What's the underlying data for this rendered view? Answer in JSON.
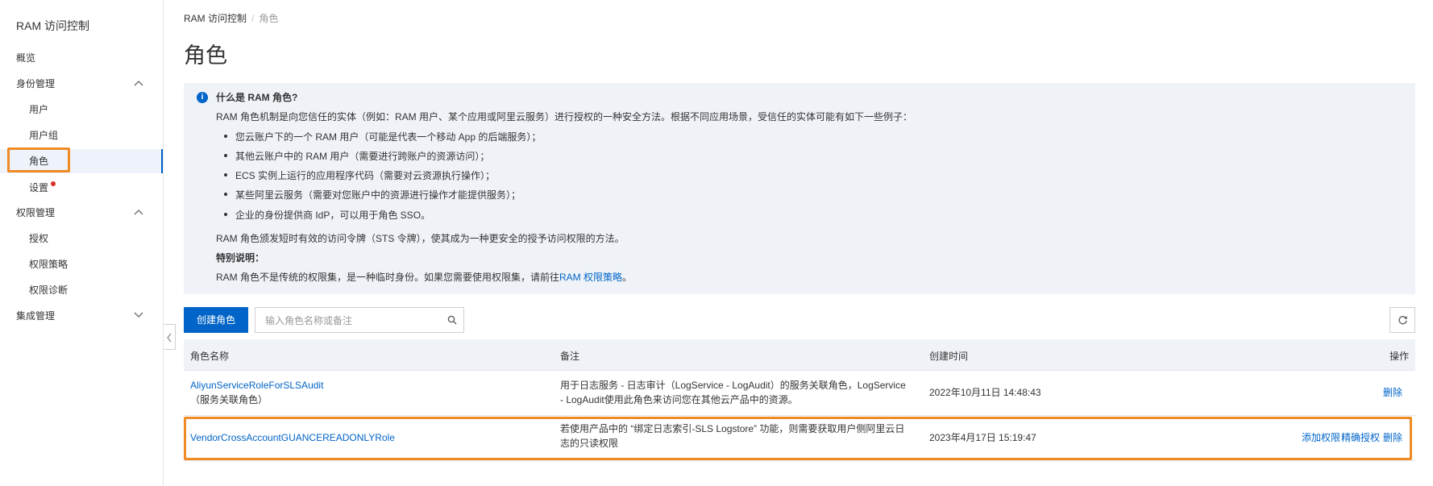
{
  "sidebar": {
    "title": "RAM 访问控制",
    "items": [
      {
        "label": "概览"
      },
      {
        "label": "身份管理"
      },
      {
        "label": "用户"
      },
      {
        "label": "用户组"
      },
      {
        "label": "角色"
      },
      {
        "label": "设置"
      },
      {
        "label": "权限管理"
      },
      {
        "label": "授权"
      },
      {
        "label": "权限策略"
      },
      {
        "label": "权限诊断"
      },
      {
        "label": "集成管理"
      }
    ],
    "active_item": "角色"
  },
  "breadcrumb": {
    "root": "RAM 访问控制",
    "current": "角色"
  },
  "page_title": "角色",
  "info": {
    "title": "什么是 RAM 角色?",
    "intro": "RAM 角色机制是向您信任的实体（例如：RAM 用户、某个应用或阿里云服务）进行授权的一种安全方法。根据不同应用场景，受信任的实体可能有如下一些例子：",
    "bullets": [
      "您云账户下的一个 RAM 用户（可能是代表一个移动 App 的后端服务）；",
      "其他云账户中的 RAM 用户（需要进行跨账户的资源访问）；",
      "ECS 实例上运行的应用程序代码（需要对云资源执行操作）；",
      "某些阿里云服务（需要对您账户中的资源进行操作才能提供服务）；",
      "企业的身份提供商 IdP，可以用于角色 SSO。"
    ],
    "sts_line": "RAM 角色颁发短时有效的访问令牌（STS 令牌），使其成为一种更安全的授予访问权限的方法。",
    "special_title": "特别说明：",
    "special_text": "RAM 角色不是传统的权限集，是一种临时身份。如果您需要使用权限集，请前往",
    "special_link": "RAM 权限策略",
    "special_end": "。"
  },
  "toolbar": {
    "create_label": "创建角色",
    "search_placeholder": "输入角色名称或备注"
  },
  "table": {
    "headers": [
      "角色名称",
      "备注",
      "创建时间",
      "操作"
    ],
    "rows": [
      {
        "name": "AliyunServiceRoleForSLSAudit",
        "tag": "（服务关联角色）",
        "note_line1": "用于日志服务 - 日志审计（LogService - LogAudit）的服务关联角色，LogService",
        "note_line2": "- LogAudit使用此角色来访问您在其他云产品中的资源。",
        "created": "2022年10月11日 14:48:43",
        "actions": [
          "删除"
        ]
      },
      {
        "name": "VendorCrossAccountGUANCEREADONLYRole",
        "note_line1": "若使用产品中的 “绑定日志索引-SLS Logstore” 功能，则需要获取用户侧阿里云日",
        "note_line2": "志的只读权限",
        "created": "2023年4月17日 15:19:47",
        "actions": [
          "添加权限",
          "精确授权",
          "删除"
        ]
      }
    ]
  },
  "colors": {
    "primary": "#0064c8",
    "highlight": "#f08a24",
    "info_bg": "#eff3f8",
    "badge": "#d93026"
  }
}
